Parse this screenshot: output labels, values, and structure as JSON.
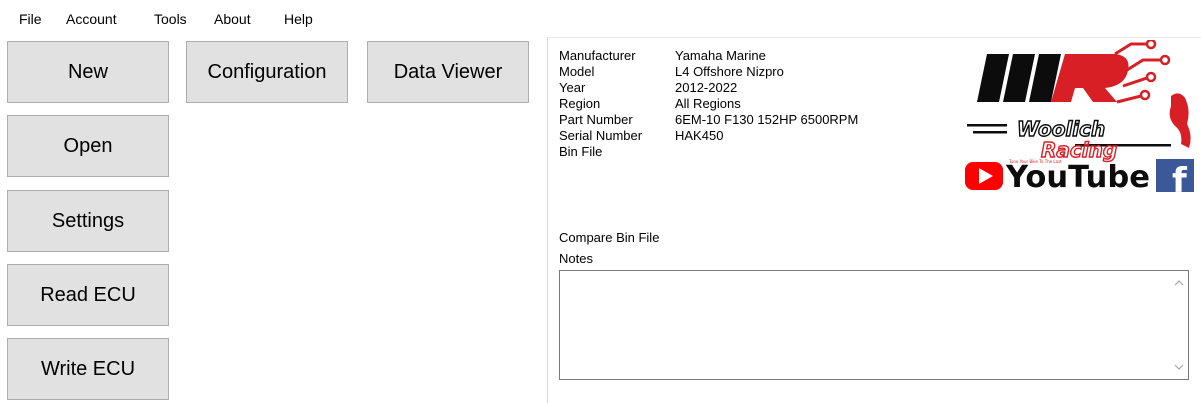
{
  "menu": {
    "file": "File",
    "account": "Account",
    "tools": "Tools",
    "about": "About",
    "help": "Help"
  },
  "buttons": {
    "new": "New",
    "open": "Open",
    "settings": "Settings",
    "read_ecu": "Read ECU",
    "write_ecu": "Write ECU",
    "configuration": "Configuration",
    "data_viewer": "Data Viewer"
  },
  "info": {
    "manufacturer_label": "Manufacturer",
    "manufacturer_value": "Yamaha Marine",
    "model_label": "Model",
    "model_value": "L4 Offshore Nizpro",
    "year_label": "Year",
    "year_value": "2012-2022",
    "region_label": "Region",
    "region_value": "All Regions",
    "part_number_label": "Part Number",
    "part_number_value": "6EM-10 F130 152HP 6500RPM",
    "serial_number_label": "Serial Number",
    "serial_number_value": "HAK450",
    "bin_file_label": "Bin File",
    "compare_bin_file_label": "Compare Bin File",
    "notes_label": "Notes",
    "notes_value": ""
  },
  "branding": {
    "logo_line1": "Woolich",
    "logo_line2": "Racing",
    "logo_tagline": "Tune Your Bike To The Last",
    "youtube_label": "YouTube",
    "facebook_glyph": "f",
    "brand_red": "#d81f26",
    "youtube_red": "#ff0000",
    "facebook_blue": "#3b5998"
  },
  "icons": {
    "scroll_up": "chevron-up-icon",
    "scroll_down": "chevron-down-icon"
  }
}
